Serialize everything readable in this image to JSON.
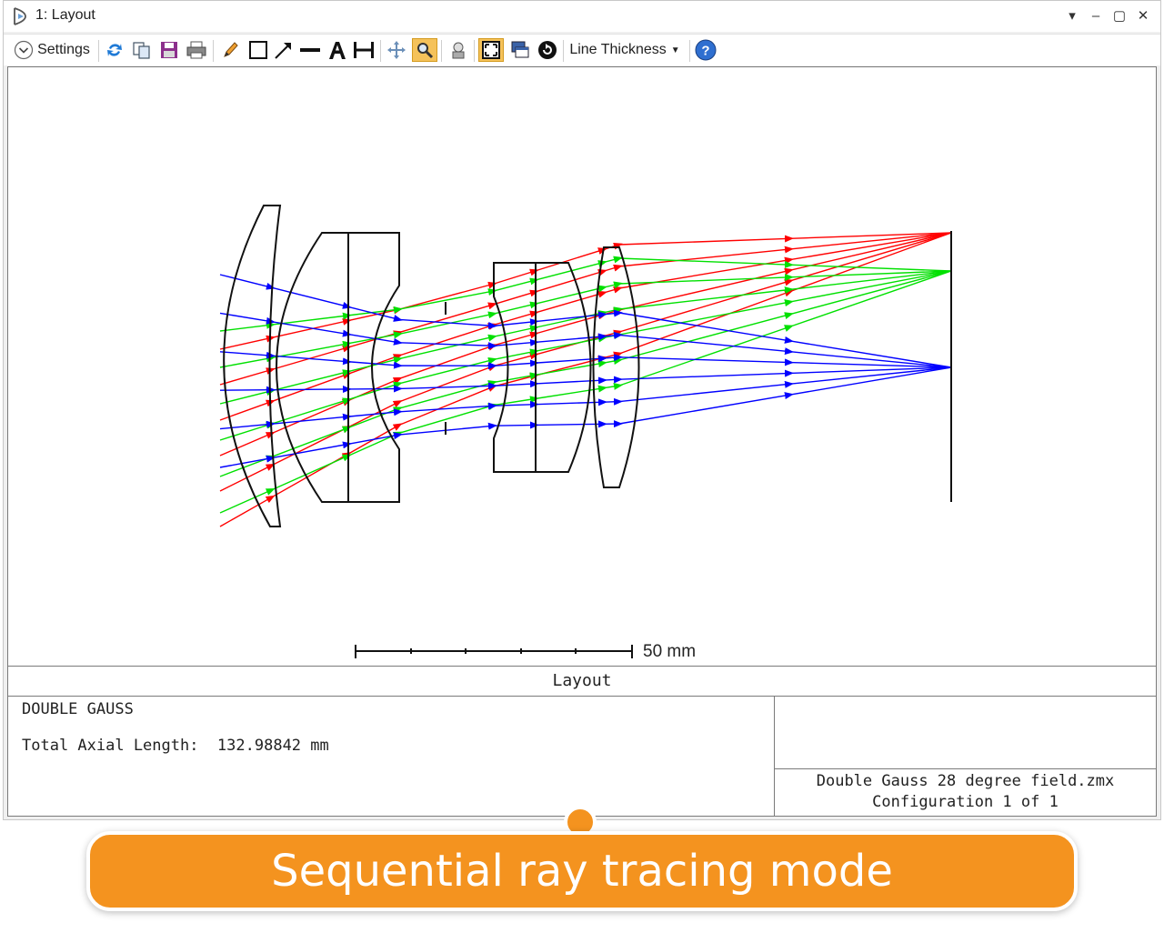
{
  "window": {
    "title": "1: Layout",
    "controls": [
      "dropdown-icon",
      "minimize-icon",
      "maximize-icon",
      "close-icon"
    ]
  },
  "toolbar": {
    "settings_label": "Settings",
    "line_thickness_label": "Line Thickness",
    "icons": [
      "refresh-icon",
      "copy-icon",
      "save-icon",
      "print-icon",
      "pencil-icon",
      "rectangle-icon",
      "arrow-icon",
      "line-icon",
      "text-icon",
      "dimension-icon",
      "pan-icon",
      "zoom-icon",
      "lock-icon",
      "fit-icon",
      "clone-icon",
      "rotate-icon",
      "help-icon"
    ]
  },
  "plot": {
    "scale_bar_label": "50 mm",
    "ray_colors": {
      "field_1": "#0000ff",
      "field_2": "#00e000",
      "field_3": "#ff0000"
    }
  },
  "info": {
    "title": "Layout",
    "lens_name": "DOUBLE GAUSS",
    "axial_length": "Total Axial Length:  132.98842 mm",
    "file_name": "Double Gauss 28 degree field.zmx",
    "configuration": "Configuration 1 of 1"
  },
  "banner": {
    "text": "Sequential ray tracing mode"
  }
}
